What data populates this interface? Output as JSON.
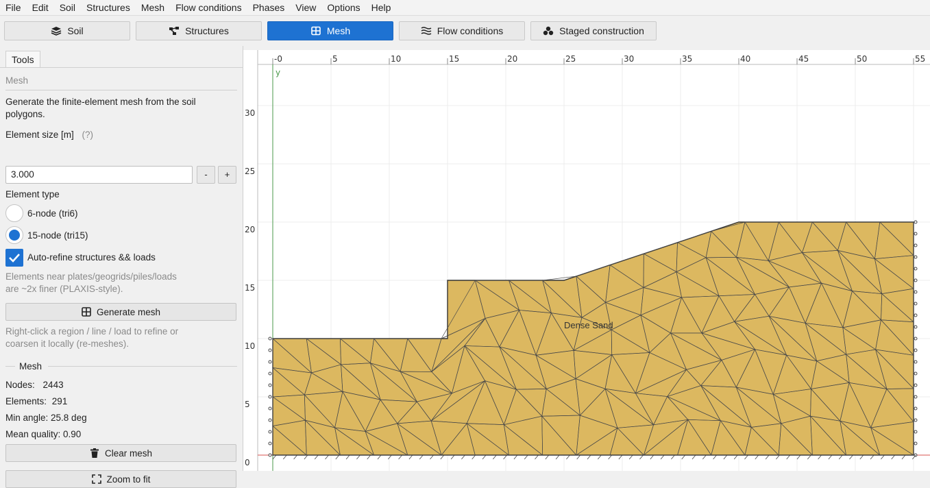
{
  "menu": [
    "File",
    "Edit",
    "Soil",
    "Structures",
    "Mesh",
    "Flow conditions",
    "Phases",
    "View",
    "Options",
    "Help"
  ],
  "toolbar": {
    "soil": "Soil",
    "structures": "Structures",
    "mesh": "Mesh",
    "flow": "Flow conditions",
    "staged": "Staged construction",
    "active": "Mesh",
    "accent": "#1e72d2"
  },
  "panel": {
    "tab": "Tools",
    "section_title": "Mesh",
    "description": "Generate the finite-element mesh from the soil polygons.",
    "element_size_label": "Element size [m]",
    "element_size_help": "(?)",
    "element_size_value": "3.000",
    "minus": "-",
    "plus": "+",
    "element_type_label": "Element type",
    "option_tri6": "6-node (tri6)",
    "option_tri15": "15-node (tri15)",
    "selected_type": "tri15",
    "auto_refine_label": "Auto-refine structures && loads",
    "auto_refine_checked": true,
    "refine_note": "Elements near plates/geogrids/piles/loads are ~2x finer (PLAXIS-style).",
    "generate_button": "Generate mesh",
    "right_click_note": "Right-click a region / line / load to refine or coarsen it locally (re-meshes).",
    "mesh_group": "Mesh",
    "nodes_label": "Nodes:",
    "nodes_value": "2443",
    "elements_label": "Elements:",
    "elements_value": "291",
    "min_angle": "Min angle: 25.8 deg",
    "mean_quality": "Mean quality: 0.90",
    "clear_button": "Clear mesh",
    "zoom_button": "Zoom to fit"
  },
  "canvas": {
    "x_ticks": [
      "-0",
      "5",
      "10",
      "15",
      "20",
      "25",
      "30",
      "35",
      "40",
      "45",
      "50",
      "55"
    ],
    "y_ticks": [
      "0",
      "5",
      "10",
      "15",
      "20",
      "25",
      "30"
    ],
    "y_axis_label": "y",
    "soil_label": "Dense Sand",
    "soil_color": "#dcb860",
    "mesh_line_color": "#4a4a4a"
  }
}
